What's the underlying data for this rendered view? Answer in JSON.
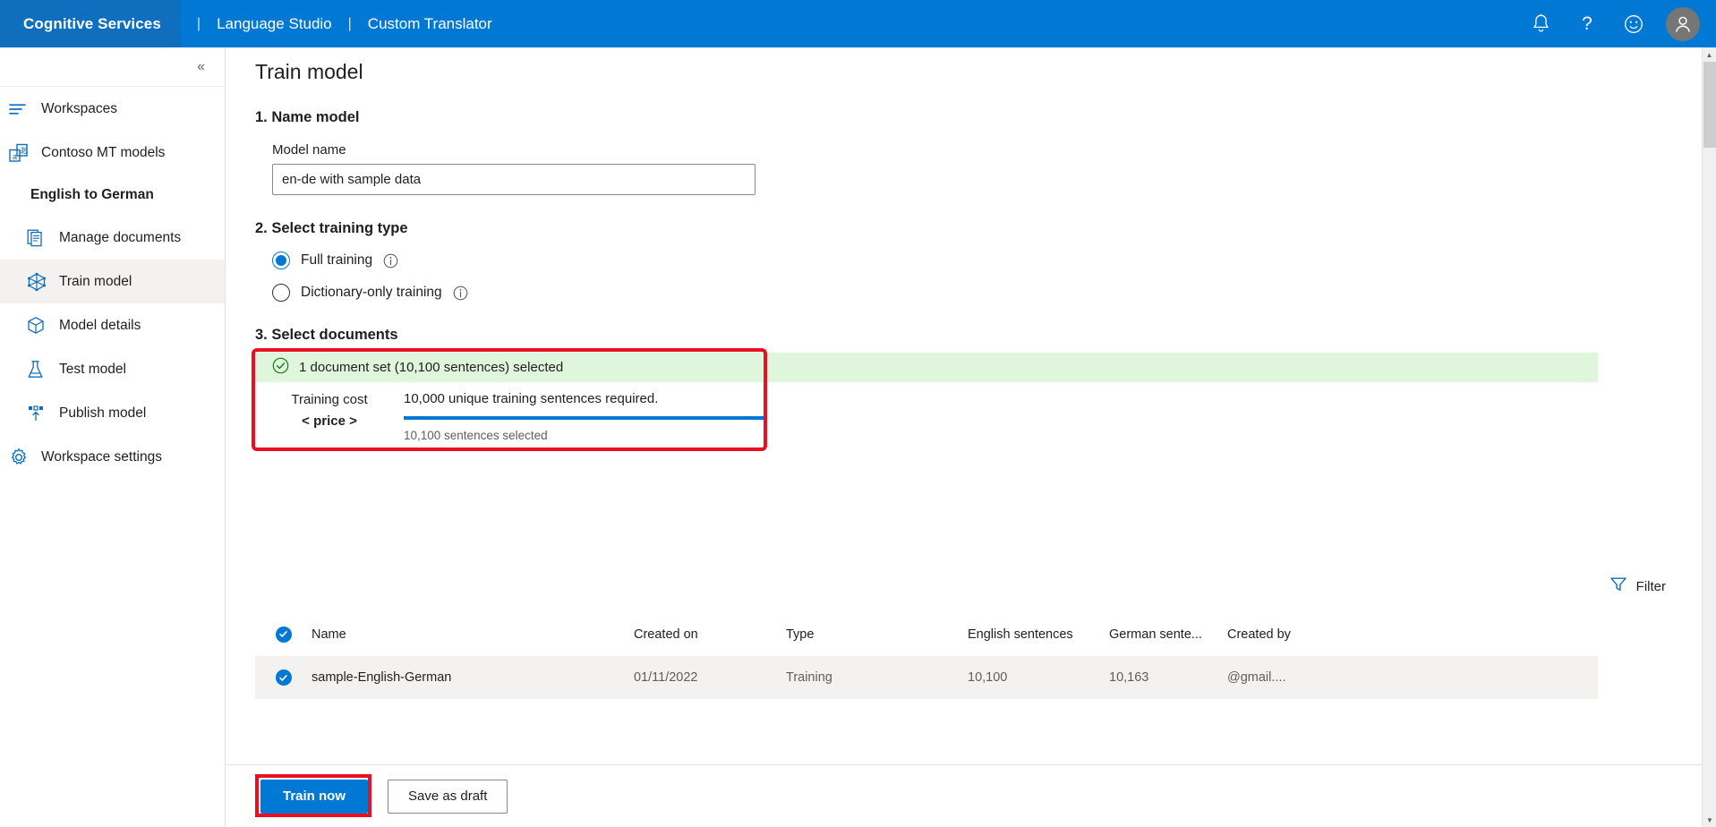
{
  "topbar": {
    "brand": "Cognitive Services",
    "separator": "|",
    "links": [
      {
        "label": "Language Studio"
      },
      {
        "label": "Custom Translator"
      }
    ],
    "icons": [
      {
        "name": "notification-bell-icon"
      },
      {
        "name": "help-question-icon"
      },
      {
        "name": "feedback-smiley-icon"
      },
      {
        "name": "user-avatar-icon"
      }
    ],
    "background": "#0078d4",
    "brand_background": "#106ebe"
  },
  "sidebar": {
    "collapse_label": "«",
    "items": [
      {
        "label": "Workspaces",
        "icon": "workspaces-list-icon",
        "active": false,
        "indent": false
      },
      {
        "label": "Contoso MT models",
        "icon": "translate-models-icon",
        "active": false,
        "indent": false
      }
    ],
    "project_heading": "English to German",
    "project_items": [
      {
        "label": "Manage documents",
        "icon": "documents-icon",
        "active": false
      },
      {
        "label": "Train model",
        "icon": "train-model-icon",
        "active": true
      },
      {
        "label": "Model details",
        "icon": "model-details-box-icon",
        "active": false
      },
      {
        "label": "Test model",
        "icon": "test-flask-icon",
        "active": false
      },
      {
        "label": "Publish model",
        "icon": "publish-upload-icon",
        "active": false
      }
    ],
    "settings_item": {
      "label": "Workspace settings",
      "icon": "gear-icon"
    }
  },
  "main": {
    "page_title": "Train model",
    "step1": {
      "heading": "1. Name model",
      "field_label": "Model name",
      "model_name_value": "en-de with sample data",
      "model_name_placeholder": "Model name"
    },
    "step2": {
      "heading": "2. Select training type",
      "options": [
        {
          "label": "Full training",
          "selected": true,
          "info": "i"
        },
        {
          "label": "Dictionary-only training",
          "selected": false,
          "info": "i"
        }
      ]
    },
    "step3": {
      "heading": "3. Select documents",
      "banner_text": "1 document set (10,100 sentences) selected",
      "banner_icon": "check-circle-icon",
      "banner_color": "#dff6dd",
      "cost_title": "Training cost",
      "cost_price": "< price >",
      "requirement_text": "10,000 unique training sentences required.",
      "selected_text": "10,100 sentences selected",
      "progress_color": "#0078d4",
      "highlight_color": "#e81123"
    },
    "filter": {
      "label": "Filter",
      "icon": "filter-funnel-icon"
    },
    "table": {
      "columns": [
        "Name",
        "Created on",
        "Type",
        "English sentences",
        "German sente...",
        "Created by"
      ],
      "header_checkbox_checked": true,
      "rows": [
        {
          "checked": true,
          "name": "sample-English-German",
          "created_on": "01/11/2022",
          "type": "Training",
          "english_sentences": "10,100",
          "german_sentences": "10,163",
          "created_by": "@gmail...."
        }
      ]
    },
    "footer": {
      "primary_label": "Train now",
      "secondary_label": "Save as draft"
    }
  }
}
